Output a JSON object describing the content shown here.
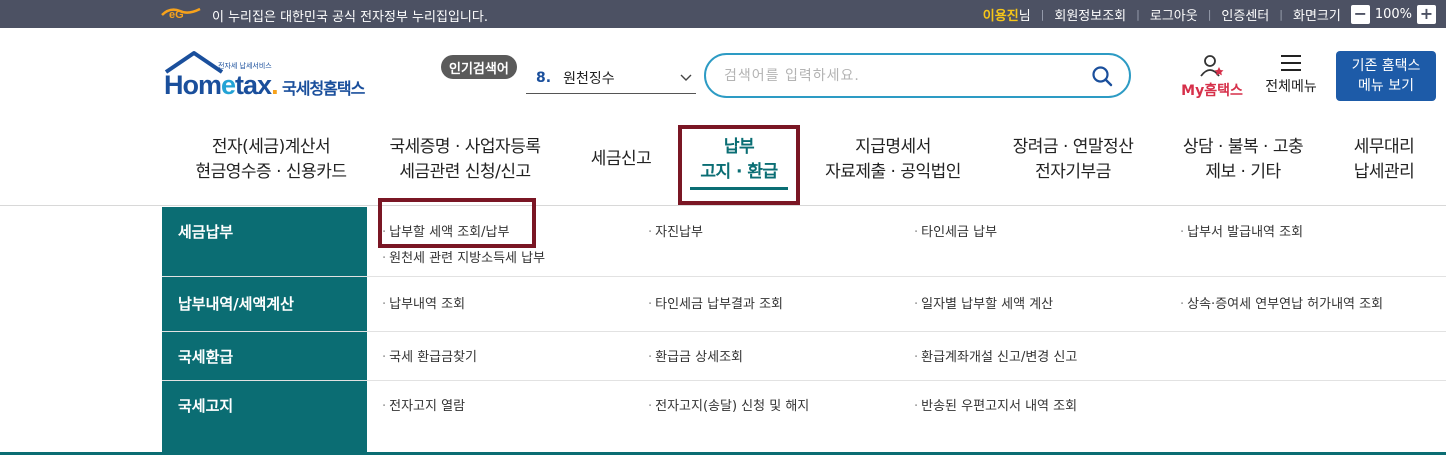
{
  "gov_bar": {
    "notice": "이 누리집은 대한민국 공식 전자정부 누리집입니다.",
    "user_name": "이용진",
    "user_suffix": "님",
    "links": [
      "회원정보조회",
      "로그아웃",
      "인증센터",
      "화면크기"
    ],
    "zoom_minus": "−",
    "zoom_value": "100%",
    "zoom_plus": "+"
  },
  "header": {
    "logo_sub": "전자세 납세서비스",
    "logo_main_1": "Hom",
    "logo_main_e": "e",
    "logo_main_2": "tax",
    "logo_main_dot": ".",
    "logo_kr": "국세청홈택스",
    "popular_label": "인기검색어",
    "popular_rank": "8.",
    "popular_term": "원천징수",
    "search_placeholder": "검색어를 입력하세요.",
    "my_hometax": "My홈택스",
    "all_menu": "전체메뉴",
    "old_menu_line1": "기존 홈택스",
    "old_menu_line2": "메뉴 보기"
  },
  "nav": [
    {
      "line1": "전자(세금)계산서",
      "line2": "현금영수증 · 신용카드"
    },
    {
      "line1": "국세증명 · 사업자등록",
      "line2": "세금관련 신청/신고"
    },
    {
      "line1": "세금신고",
      "line2": ""
    },
    {
      "line1": "납부",
      "line2": "고지 · 환급",
      "active": true
    },
    {
      "line1": "지급명세서",
      "line2": "자료제출 · 공익법인"
    },
    {
      "line1": "장려금 · 연말정산",
      "line2": "전자기부금"
    },
    {
      "line1": "상담 · 불복 · 고충",
      "line2": "제보 · 기타"
    },
    {
      "line1": "세무대리",
      "line2": "납세관리"
    }
  ],
  "mega": [
    {
      "title": "세금납부",
      "links": [
        "납부할 세액 조회/납부",
        "자진납부",
        "타인세금 납부",
        "납부서 발급내역 조회",
        "원천세 관련 지방소득세 납부"
      ]
    },
    {
      "title": "납부내역/세액계산",
      "links": [
        "납부내역 조회",
        "타인세금 납부결과 조회",
        "일자별 납부할 세액 계산",
        "상속·증여세 연부연납 허가내역 조회"
      ]
    },
    {
      "title": "국세환급",
      "links": [
        "국세 환급금찾기",
        "환급금 상세조회",
        "환급계좌개설 신고/변경 신고"
      ]
    },
    {
      "title": "국세고지",
      "links": [
        "전자고지 열람",
        "전자고지(송달) 신청 및 해지",
        "반송된 우편고지서 내역 조회"
      ]
    }
  ],
  "colors": {
    "gov_bar": "#4c5163",
    "brand_blue": "#1a4f9c",
    "teal": "#0b6d73",
    "highlight": "#7a1624",
    "search_border": "#2d9bc4"
  }
}
